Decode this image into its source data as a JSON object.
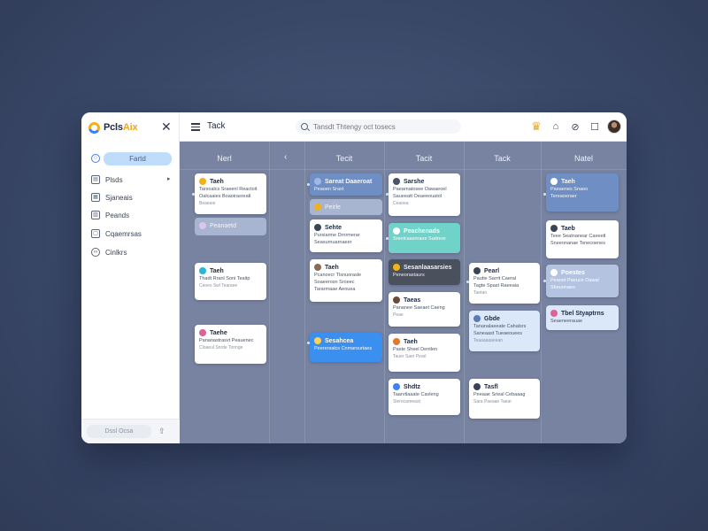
{
  "app": {
    "brand_prefix": "Pcls",
    "brand_accent": "Aix",
    "accent_color": "#3b82f6",
    "brand_color": "#f2a518"
  },
  "sidebar": {
    "primary_button": "Fartd",
    "items": [
      {
        "label": "Plsds",
        "icon": "document-icon"
      },
      {
        "label": "Sjaneais",
        "icon": "calendar-icon"
      },
      {
        "label": "Peands",
        "icon": "board-icon"
      },
      {
        "label": "Cqaemrsas",
        "icon": "clipboard-icon"
      },
      {
        "label": "Cinlkrs",
        "icon": "link-icon"
      }
    ],
    "footer_button": "Dssl Ocsa"
  },
  "topbar": {
    "title": "Tack",
    "search_placeholder": "Tansdt Thtengy oct tosecs"
  },
  "board": {
    "columns": [
      {
        "title": "Nerl"
      },
      {
        "title": "Tecit"
      },
      {
        "title": "Tacit"
      },
      {
        "title": "Tack"
      },
      {
        "title": "Natel"
      }
    ],
    "cards": [
      {
        "id": "c1",
        "style": "white",
        "dot": "#f2b118",
        "title": "Taeh",
        "lines": [
          "Tarsoalcs Sraeenl Reactoit",
          "Oalcaaies Boaoirasreatl"
        ],
        "sub": "Beaeaie"
      },
      {
        "id": "c2",
        "style": "ghost",
        "dot": "#d9c7f0",
        "title": "Peanaetd",
        "lines": [],
        "sub": ""
      },
      {
        "id": "c3",
        "style": "white",
        "dot": "#29b6d8",
        "title": "Taeh",
        "lines": [
          "Thadt Rranl Soni Teaitp"
        ],
        "sub": "Ceoes Swl Tearaee"
      },
      {
        "id": "c4",
        "style": "white",
        "dot": "#e0609a",
        "title": "Taehe",
        "lines": [
          "Pananastrasvt Peauenec"
        ],
        "sub": "Cloaeul Snrde Tonnge"
      },
      {
        "id": "c5",
        "style": "steel",
        "dot": "#9fb8e6",
        "title": "Sareat Daaeroat",
        "lines": [
          "Peaoen Sraxt"
        ],
        "sub": ""
      },
      {
        "id": "c6",
        "style": "ghost",
        "dot": "#f2b118",
        "title": "Peirle",
        "lines": [],
        "sub": ""
      },
      {
        "id": "c7",
        "style": "white",
        "dot": "#3a4458",
        "title": "Sehte",
        "lines": [
          "Pursiarme Drnrmerar",
          "Seaxurnuarnaeer"
        ],
        "sub": ""
      },
      {
        "id": "c8",
        "style": "white",
        "dot": "#8a6a55",
        "title": "Taeh",
        "lines": [
          "Pcanoecr Tlsnuorasle",
          "Soaeerosn Sroeec",
          "Tararmaae Aeouea"
        ],
        "sub": ""
      },
      {
        "id": "c9",
        "style": "blue",
        "dot": "#ffd34d",
        "title": "Sesahcea",
        "lines": [
          "Peerersalcs Cnmarsurtaes"
        ],
        "sub": ""
      },
      {
        "id": "c10",
        "style": "white",
        "dot": "#4a5468",
        "title": "Sarshe",
        "lines": [
          "Paearnatosee Oawaeoel",
          "Saueeatt Oeaeeouatol"
        ],
        "sub": "Ceaoea"
      },
      {
        "id": "c11",
        "style": "teal",
        "dot": "#ffffff",
        "title": "Peachenads",
        "lines": [
          "Sreolcaasnraoe Sadrere"
        ],
        "sub": ""
      },
      {
        "id": "c12",
        "style": "dark",
        "dot": "#f2b118",
        "title": "Sesanlaasarsies",
        "lines": [
          "Peneorastaurs"
        ],
        "sub": ""
      },
      {
        "id": "c13",
        "style": "white",
        "dot": "#6a4a3a",
        "title": "Taeas",
        "lines": [
          "Pananee Saeaet Caeng"
        ],
        "sub": "Peae"
      },
      {
        "id": "c14",
        "style": "white",
        "dot": "#e07a2a",
        "title": "Taeh",
        "lines": [
          "Paste Sheel Dentlen"
        ],
        "sub": "Tauer Saer Pearl"
      },
      {
        "id": "c15",
        "style": "white",
        "dot": "#3b82f6",
        "title": "Shdtz",
        "lines": [
          "Taarvtlaaate Cavleng"
        ],
        "sub": "Slerocareeast"
      },
      {
        "id": "c16",
        "style": "white",
        "dot": "#3a4458",
        "title": "Pearl",
        "lines": [
          "Pautie Sarrit Caeral",
          "Tagte Spast Raeeaia"
        ],
        "sub": "Taetao"
      },
      {
        "id": "c17",
        "style": "sky",
        "dot": "#5b7bb8",
        "title": "Gbde",
        "lines": [
          "Tananalaeeate Cahalsrs",
          "Saneaast Tueaeouees"
        ],
        "sub": "Teaaaaaaeean"
      },
      {
        "id": "c18",
        "style": "white",
        "dot": "#3a4458",
        "title": "Tasfl",
        "lines": [
          "Peeaae Srieal Cebaaag"
        ],
        "sub": "Sara Paeaae Taear"
      },
      {
        "id": "c19",
        "style": "steel",
        "dot": "#ffffff",
        "title": "Taeh",
        "lines": [
          "Paeaenes Snaeo",
          "Tereaoeraer"
        ],
        "sub": ""
      },
      {
        "id": "c20",
        "style": "white",
        "dot": "#3a4458",
        "title": "Taeb",
        "lines": [
          "Teee Seatnanear Caeeetl",
          "Sneeonanae Tsnecoenes"
        ],
        "sub": ""
      },
      {
        "id": "c21",
        "style": "lightsteel",
        "dot": "#ffffff",
        "title": "Poestes",
        "lines": [
          "Peanet Paeuce Oawal",
          "Sbeuonaes"
        ],
        "sub": ""
      },
      {
        "id": "c22",
        "style": "sky",
        "dot": "#e0609a",
        "title": "Tbel Styaptrns",
        "lines": [
          "Seaeneerauae"
        ],
        "sub": ""
      }
    ]
  }
}
